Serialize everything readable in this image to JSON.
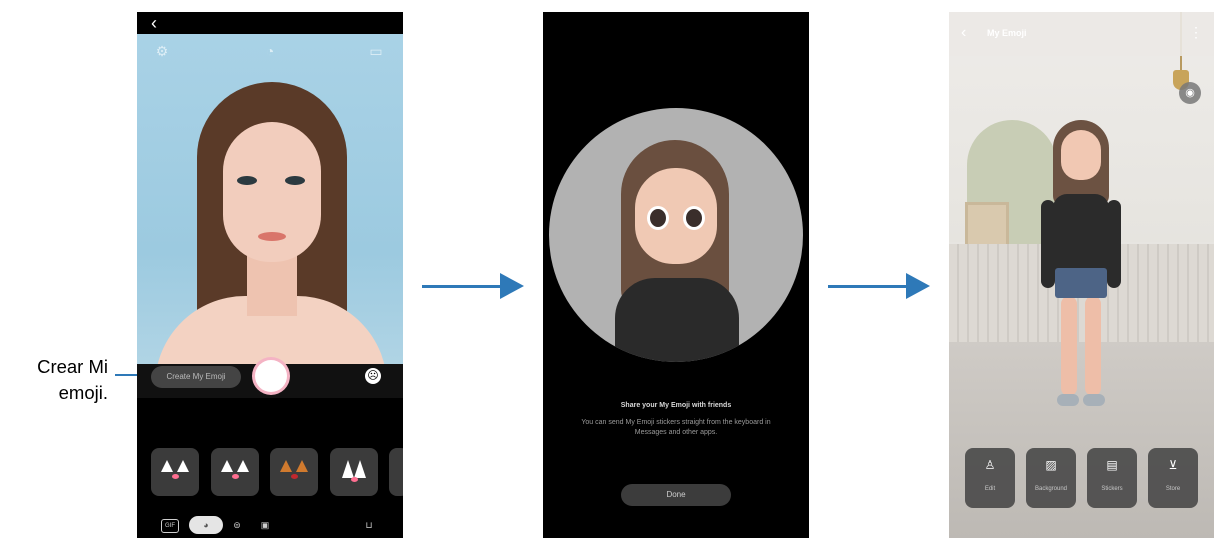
{
  "callout": {
    "line1": "Crear Mi",
    "line2": "emoji."
  },
  "phone1": {
    "back_glyph": "‹",
    "top_icons": [
      "settings-icon",
      "timer-icon",
      "ratio-icon"
    ],
    "create_button_label": "Create My Emoji",
    "sticker_items": [
      "cat-sticker",
      "fox-sticker",
      "dog-sticker",
      "bunny-sticker"
    ],
    "bottom_icons": [
      "gif-icon",
      "sticker-mode-icon",
      "ar-mode-icon",
      "my-emoji-icon",
      "store-icon"
    ],
    "gif_label": "GIF"
  },
  "phone2": {
    "title": "Share your My Emoji with friends",
    "description": "You can send My Emoji stickers straight from the keyboard in Messages and other apps.",
    "done_label": "Done"
  },
  "phone3": {
    "title": "My Emoji",
    "buttons": [
      {
        "label": "Edit",
        "icon": "person-icon"
      },
      {
        "label": "Background",
        "icon": "image-icon"
      },
      {
        "label": "Stickers",
        "icon": "sticker-icon"
      },
      {
        "label": "Store",
        "icon": "cart-icon"
      }
    ]
  },
  "colors": {
    "arrow": "#2e79b8"
  }
}
